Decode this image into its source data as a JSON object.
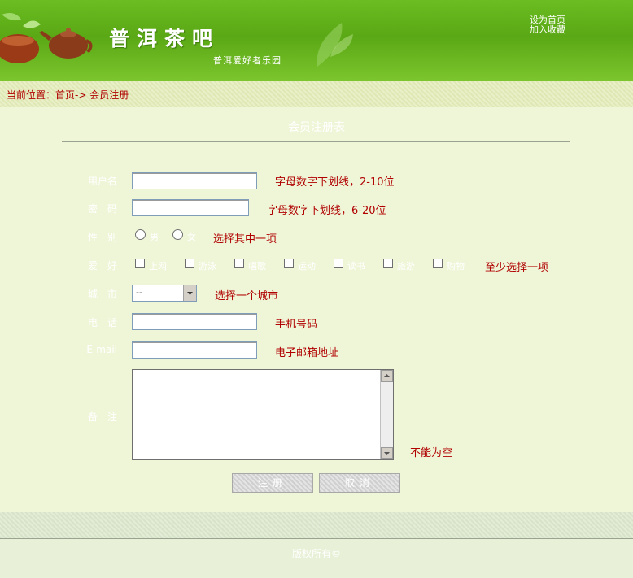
{
  "header": {
    "title": "普洱茶吧",
    "subtitle": "普洱爱好者乐园",
    "links": [
      "设为首页",
      "加入收藏"
    ]
  },
  "breadcrumb": "当前位置：首页-> 会员注册",
  "form": {
    "title": "会员注册表",
    "username": {
      "label": "用户名",
      "hint": "字母数字下划线，2-10位"
    },
    "password": {
      "label": "密　码",
      "hint": "字母数字下划线，6-20位"
    },
    "gender": {
      "label": "性　别",
      "options": [
        "男",
        "女"
      ],
      "hint": "选择其中一项"
    },
    "hobby": {
      "label": "爱　好",
      "options": [
        "上网",
        "游泳",
        "唱歌",
        "运动",
        "读书",
        "旅游",
        "购物"
      ],
      "hint": "至少选择一项"
    },
    "city": {
      "label": "城　市",
      "value": "--",
      "hint": "选择一个城市"
    },
    "phone": {
      "label": "电　话",
      "hint": "手机号码"
    },
    "email": {
      "label": "E-mail",
      "hint": "电子邮箱地址"
    },
    "notes": {
      "label": "备　注",
      "hint": "不能为空"
    },
    "submit_label": "注册",
    "cancel_label": "取消"
  },
  "footer": "版权所有©"
}
